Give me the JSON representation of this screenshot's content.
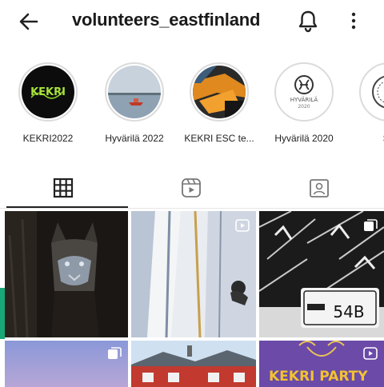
{
  "header": {
    "username": "volunteers_eastfinland",
    "back_icon": "arrow-left-icon",
    "bell_icon": "bell-icon",
    "more_icon": "more-vertical-icon"
  },
  "highlights": [
    {
      "label": "KEKRI2022",
      "logo_text": "KEKRI"
    },
    {
      "label": "Hyvärilä 2022"
    },
    {
      "label": "KEKRI ESC te..."
    },
    {
      "label": "Hyvärilä 2020",
      "logo_text": "HYVÄRILÄ",
      "logo_year": "2020"
    },
    {
      "label": "Sa"
    }
  ],
  "tabs": [
    {
      "name": "posts",
      "icon": "grid-icon",
      "selected": true
    },
    {
      "name": "reels",
      "icon": "reels-icon",
      "selected": false
    },
    {
      "name": "tagged",
      "icon": "tagged-icon",
      "selected": false
    }
  ],
  "posts": [
    {
      "kind": "photo"
    },
    {
      "kind": "reel"
    },
    {
      "kind": "carousel",
      "sign_text": "54B"
    },
    {
      "kind": "carousel"
    },
    {
      "kind": "photo"
    },
    {
      "kind": "reel",
      "overlay_text": "KEKRI PARTY"
    }
  ],
  "colors": {
    "accent": "#18a877",
    "selected_tab": "#222222"
  }
}
